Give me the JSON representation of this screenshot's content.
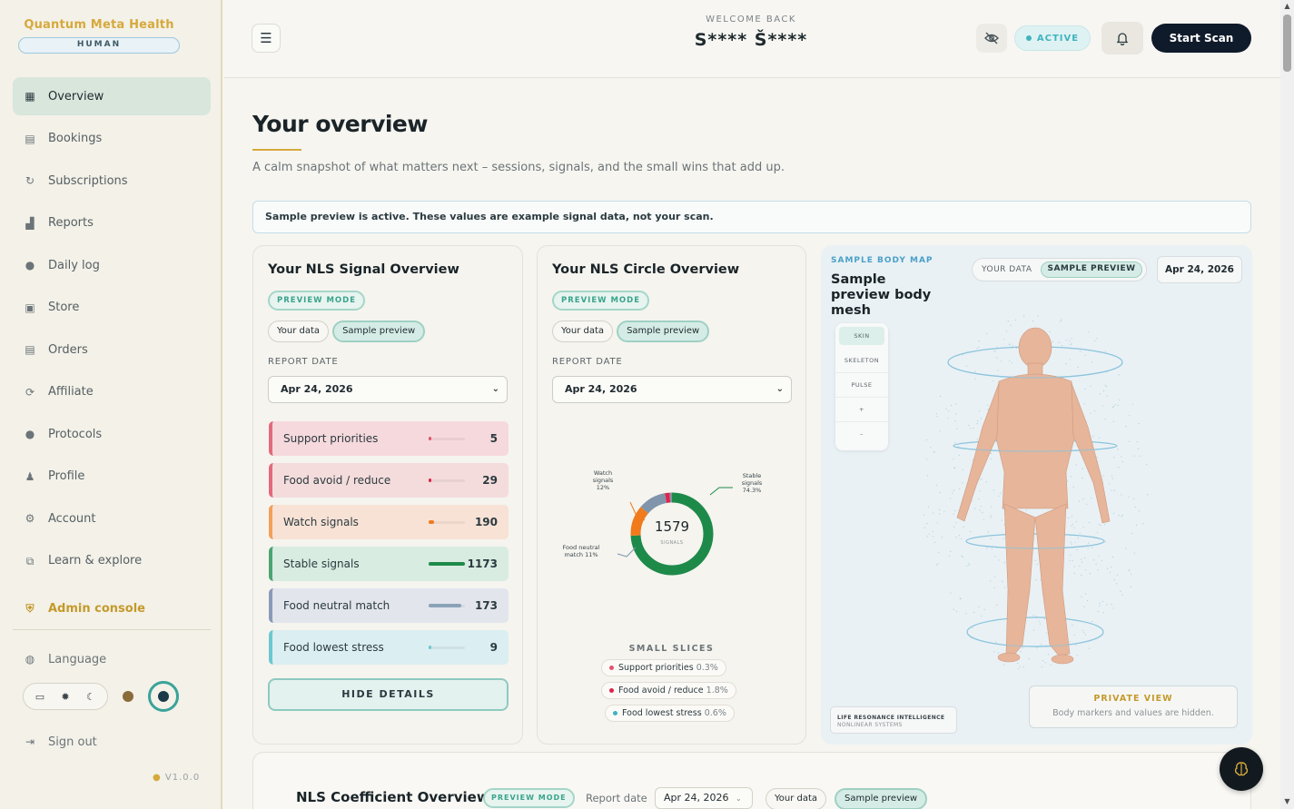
{
  "sidebar": {
    "brand": "Quantum Meta Health",
    "badge": "HUMAN",
    "items": [
      {
        "label": "Overview",
        "icon": "grid-icon",
        "active": true
      },
      {
        "label": "Bookings",
        "icon": "calendar-icon"
      },
      {
        "label": "Subscriptions",
        "icon": "refresh-icon"
      },
      {
        "label": "Reports",
        "icon": "bar-chart-icon"
      },
      {
        "label": "Daily log",
        "icon": "log-icon"
      },
      {
        "label": "Store",
        "icon": "bag-icon"
      },
      {
        "label": "Orders",
        "icon": "box-icon"
      },
      {
        "label": "Affiliate",
        "icon": "link-icon"
      },
      {
        "label": "Protocols",
        "icon": "protocol-icon"
      },
      {
        "label": "Profile",
        "icon": "user-icon"
      },
      {
        "label": "Account",
        "icon": "gear-icon"
      },
      {
        "label": "Learn & explore",
        "icon": "external-icon"
      }
    ],
    "admin": "Admin console",
    "language": "Language",
    "signout": "Sign out",
    "version": "V1.0.0"
  },
  "header": {
    "welcome_small": "WELCOME BACK",
    "user_name": "S**** Š****",
    "status": "ACTIVE",
    "scan_button": "Start Scan"
  },
  "main": {
    "title": "Your overview",
    "subtitle": "A calm snapshot of what matters next – sessions, signals, and the small wins that add up.",
    "notice": "Sample preview is active. These values are example signal data, not your scan."
  },
  "signal_card": {
    "title": "Your NLS Signal Overview",
    "badge": "PREVIEW MODE",
    "toggle_your": "Your data",
    "toggle_sample": "Sample preview",
    "report_label": "REPORT DATE",
    "date": "Apr 24, 2026",
    "rows": [
      {
        "label": "Support priorities",
        "value": "5",
        "fill": 0.004,
        "bg": "#f6d9dd",
        "border": "#e26a7c",
        "bar": "#e2546c"
      },
      {
        "label": "Food avoid / reduce",
        "value": "29",
        "fill": 0.025,
        "bg": "#f4dcdc",
        "border": "#e26a7c",
        "bar": "#e0234a"
      },
      {
        "label": "Watch signals",
        "value": "190",
        "fill": 0.16,
        "bg": "#f7e2d5",
        "border": "#f2a05a",
        "bar": "#f07a1c"
      },
      {
        "label": "Stable signals",
        "value": "1173",
        "fill": 1.0,
        "bg": "#d9ece1",
        "border": "#4aa572",
        "bar": "#1e8a4a"
      },
      {
        "label": "Food neutral match",
        "value": "173",
        "fill": 0.9,
        "bg": "#e2e5ec",
        "border": "#8a9ab8",
        "bar": "#8aa2b8"
      },
      {
        "label": "Food lowest stress",
        "value": "9",
        "fill": 0.008,
        "bg": "#dbeef1",
        "border": "#6cc8d0",
        "bar": "#6cc8d0"
      }
    ],
    "hide_details": "HIDE DETAILS"
  },
  "circle_card": {
    "title": "Your NLS Circle Overview",
    "badge": "PREVIEW MODE",
    "toggle_your": "Your data",
    "toggle_sample": "Sample preview",
    "report_label": "REPORT DATE",
    "date": "Apr 24, 2026",
    "center_value": "1579",
    "center_label": "SIGNALS",
    "label_watch": [
      "Watch",
      "signals",
      "12%"
    ],
    "label_stable": [
      "Stable",
      "signals",
      "74.3%"
    ],
    "label_neutral": [
      "Food neutral",
      "match 11%"
    ],
    "small_slices_title": "SMALL SLICES",
    "small_slices": [
      {
        "label": "Support priorities",
        "pct": "0.3%",
        "color": "#e2546c"
      },
      {
        "label": "Food avoid / reduce",
        "pct": "1.8%",
        "color": "#e0234a"
      },
      {
        "label": "Food lowest stress",
        "pct": "0.6%",
        "color": "#3fb4bf"
      }
    ]
  },
  "chart_data": {
    "type": "pie",
    "categories": [
      "Stable signals",
      "Watch signals",
      "Food neutral match",
      "Food avoid / reduce",
      "Food lowest stress",
      "Support priorities"
    ],
    "values": [
      1173,
      190,
      173,
      29,
      9,
      5
    ],
    "colors": [
      "#1e8a4a",
      "#f07a1c",
      "#8094ab",
      "#e0234a",
      "#3fb4bf",
      "#e2546c"
    ]
  },
  "body_map": {
    "kicker": "SAMPLE BODY MAP",
    "title": "Sample preview body mesh",
    "toggle_your": "YOUR DATA",
    "toggle_sample": "SAMPLE PREVIEW",
    "date": "Apr 24, 2026",
    "layers": [
      "SKIN",
      "SKELETON",
      "PULSE",
      "+",
      "–"
    ],
    "lri_title": "LIFE RESONANCE INTELLIGENCE",
    "lri_sub": "NONLINEAR SYSTEMS",
    "private_title": "PRIVATE VIEW",
    "private_sub": "Body markers and values are hidden."
  },
  "coefficient": {
    "title": "NLS Coefficient Overview",
    "badge": "PREVIEW MODE",
    "report_label": "Report date",
    "date": "Apr 24, 2026",
    "toggle_your": "Your data",
    "toggle_sample": "Sample preview"
  }
}
